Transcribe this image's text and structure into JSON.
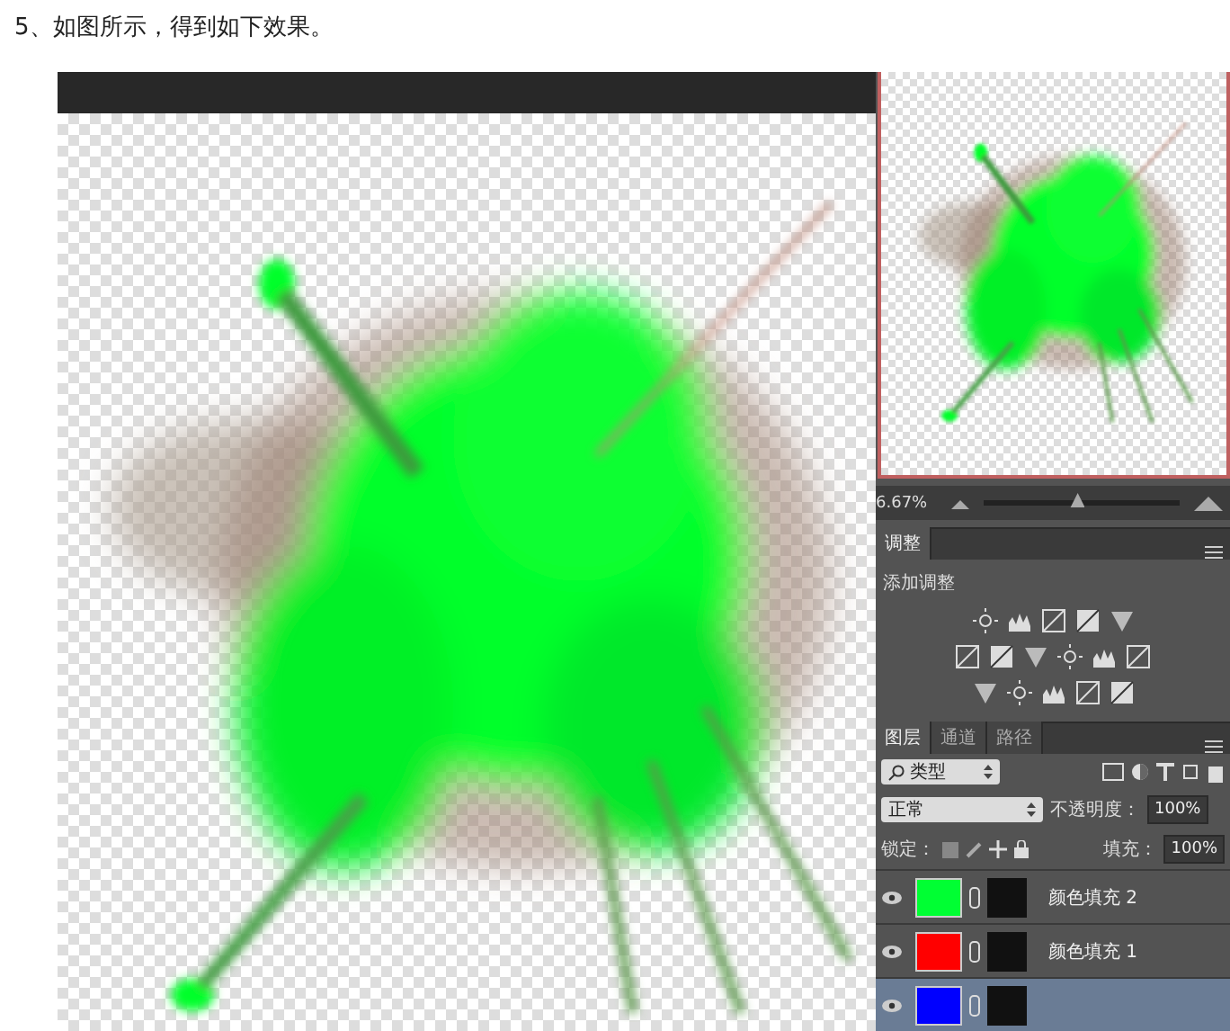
{
  "heading": "5、如图所示，得到如下效果。",
  "navigator": {
    "zoom": "6.67%",
    "level": 0.48
  },
  "adjustments": {
    "tab": "调整",
    "title": "添加调整"
  },
  "layers_panel": {
    "tabs": [
      {
        "label": "图层",
        "selected": true
      },
      {
        "label": "通道",
        "selected": false
      },
      {
        "label": "路径",
        "selected": false
      }
    ],
    "filter": "类型",
    "blend_mode": "正常",
    "opacity_label": "不透明度：",
    "opacity": "100%",
    "lock_label": "锁定：",
    "fill_label": "填充：",
    "fill": "100%",
    "layers": [
      {
        "name": "颜色填充 2",
        "color": "#00ff33",
        "selected": false
      },
      {
        "name": "颜色填充 1",
        "color": "#ff0000",
        "selected": false
      },
      {
        "color": "#0000ff",
        "selected": true
      }
    ]
  }
}
